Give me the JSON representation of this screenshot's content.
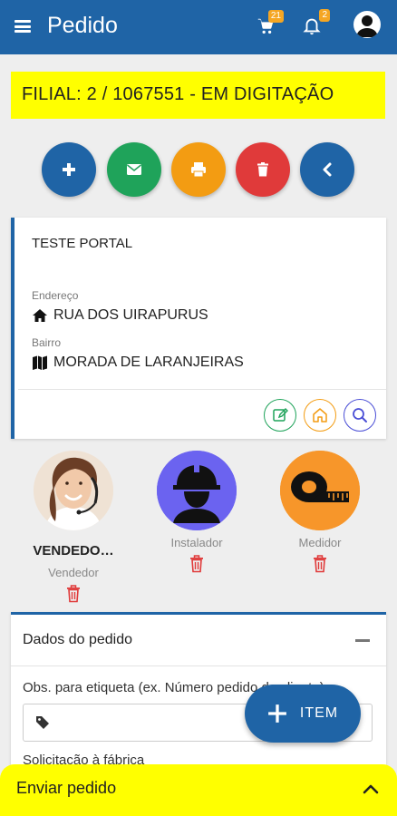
{
  "appbar": {
    "title": "Pedido",
    "cart_count": "21",
    "notification_count": "2"
  },
  "banner": {
    "text": "FILIAL: 2 / 1067551 - EM DIGITAÇÃO",
    "color": "#ffff00"
  },
  "actions": [
    {
      "name": "add",
      "icon": "plus-icon",
      "color": "#1f64a6"
    },
    {
      "name": "email",
      "icon": "envelope-icon",
      "color": "#1fa35a"
    },
    {
      "name": "print",
      "icon": "printer-icon",
      "color": "#f39c12"
    },
    {
      "name": "delete",
      "icon": "trash-icon",
      "color": "#e03a3a"
    },
    {
      "name": "back",
      "icon": "chevron-left-icon",
      "color": "#1f64a6"
    }
  ],
  "client": {
    "name": "TESTE PORTAL",
    "address_label": "Endereço",
    "address": "RUA DOS UIRAPURUS",
    "district_label": "Bairro",
    "district": "MORADA DE LARANJEIRAS"
  },
  "people": [
    {
      "name": "VENDEDO…",
      "role": "Vendedor",
      "photo": "saleswoman-photo"
    },
    {
      "name": "",
      "role": "Instalador",
      "photo": "installer-icon",
      "bg": "#6b63f0"
    },
    {
      "name": "",
      "role": "Medidor",
      "photo": "tape-measure-icon",
      "bg": "#f7962a"
    }
  ],
  "order": {
    "section_title": "Dados do pedido",
    "obs_label": "Obs. para etiqueta (ex. Número pedido do cliente)...",
    "obs_value": "",
    "request_label": "Solicitação à fábrica"
  },
  "item_button": {
    "label": "ITEM"
  },
  "send": {
    "label": "Enviar pedido"
  },
  "colors": {
    "primary": "#1f64a6",
    "highlight": "#ffff00",
    "danger": "#e03a3a"
  }
}
